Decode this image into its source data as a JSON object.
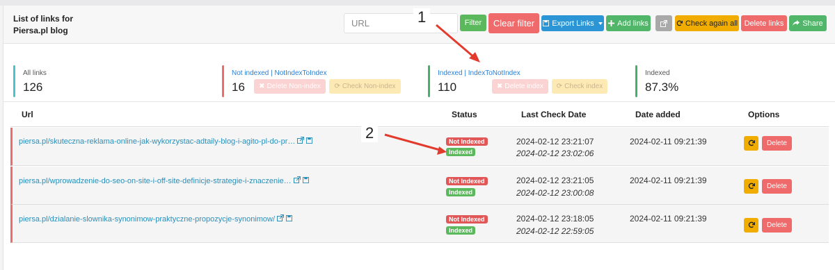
{
  "header": {
    "title_line1": "List of links for",
    "title_line2": "Piersa.pl blog",
    "search_placeholder": "URL",
    "filter_label": "Filter",
    "clear_filter_label": "Clear filter",
    "export_label": "Export Links",
    "add_label": "Add links",
    "check_again_label": "Check again all",
    "delete_links_label": "Delete links",
    "share_label": "Share"
  },
  "stats": {
    "all": {
      "label": "All links",
      "value": "126"
    },
    "not_indexed": {
      "label": "Not indexed | NotIndexToIndex",
      "value": "16",
      "delete_label": "Delete Non-index",
      "check_label": "Check Non-index"
    },
    "indexed": {
      "label": "Indexed | IndexToNotIndex",
      "value": "110",
      "delete_label": "Delete index",
      "check_label": "Check index"
    },
    "indexed_pct": {
      "label": "Indexed",
      "value": "87.3%"
    }
  },
  "table": {
    "headers": {
      "url": "Url",
      "status": "Status",
      "last_check": "Last Check Date",
      "date_added": "Date added",
      "options": "Options"
    },
    "rows": [
      {
        "url": "piersa.pl/skuteczna-reklama-online-jak-wykorzystac-adtaily-blog-i-agito-pl-do-pr…",
        "status1": "Not Indexed",
        "status2": "Indexed",
        "check1": "2024-02-12 23:21:07",
        "check2": "2024-02-12 23:02:06",
        "added": "2024-02-11 09:21:39",
        "delete_label": "Delete"
      },
      {
        "url": "piersa.pl/wprowadzenie-do-seo-on-site-i-off-site-definicje-strategie-i-znaczenie…",
        "status1": "Not Indexed",
        "status2": "Indexed",
        "check1": "2024-02-12 23:21:05",
        "check2": "2024-02-12 23:00:08",
        "added": "2024-02-11 09:21:39",
        "delete_label": "Delete"
      },
      {
        "url": "piersa.pl/dzialanie-slownika-synonimow-praktyczne-propozycje-synonimow/",
        "status1": "Not Indexed",
        "status2": "Indexed",
        "check1": "2024-02-12 23:18:05",
        "check2": "2024-02-12 22:59:05",
        "added": "2024-02-11 09:21:39",
        "delete_label": "Delete"
      }
    ]
  },
  "annotations": {
    "one": "1",
    "two": "2"
  },
  "colors": {
    "danger": "#ef6b6b",
    "success": "#5cb85c",
    "warning": "#f0ad00",
    "primary": "#2b95d6",
    "link": "#2a8fb9"
  }
}
